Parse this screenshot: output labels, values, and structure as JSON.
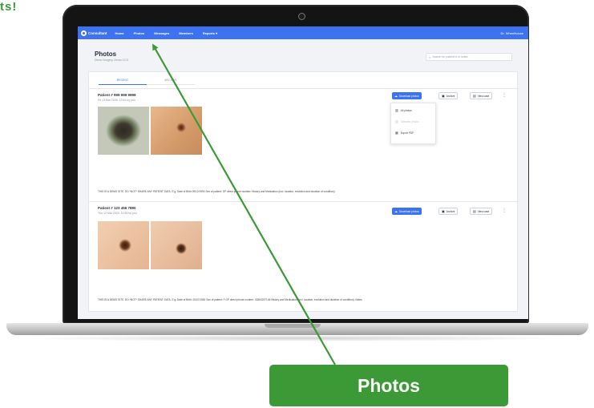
{
  "corner_label": "ts!",
  "app": {
    "logo_text": "Consultant",
    "nav": [
      "Home",
      "Photos",
      "Messages",
      "Members",
      "Reports ▾"
    ],
    "user": "Dr. Wheelhouse"
  },
  "page": {
    "title": "Photos",
    "subtitle": "Demo Surgery, Demo CCG",
    "search_placeholder": "Search for patient # or notes"
  },
  "tabs": [
    "RECENT",
    "ARCHIVE"
  ],
  "cards": [
    {
      "patient": "Patient # 999 999 9999",
      "date": "Fri 13 Mar 2020, 12:51 by you",
      "note": "THIS IS A DEMO SITE. DO *NOT* SHARE ANY PATIENT DATA. E.g. Date of Birth 09/12/1990 Sex of patient: GP direct phone number: History and Medication (incl. location, evolution and duration of condition):"
    },
    {
      "patient": "Patient # 123 456 7890",
      "date": "Thu 12 Mar 2020, 10:59 by you",
      "note": "THIS IS A DEMO SITE. DO *NOT* SHARE ANY PATIENT DATA. E.g. Date of Birth: 20/07/1981 Sex of patient: F GP direct phone number: 01863237146 History and Medication (incl. location, evolution and duration of condition): Notes"
    }
  ],
  "buttons": {
    "download": "Download photos",
    "archive": "Archive",
    "view": "View case"
  },
  "dropdown": {
    "items": [
      "All photos",
      "Selected photos",
      "Export PDF"
    ]
  },
  "callout": "Photos",
  "colors": {
    "brand": "#3d72f0",
    "callout": "#3c9a36"
  }
}
